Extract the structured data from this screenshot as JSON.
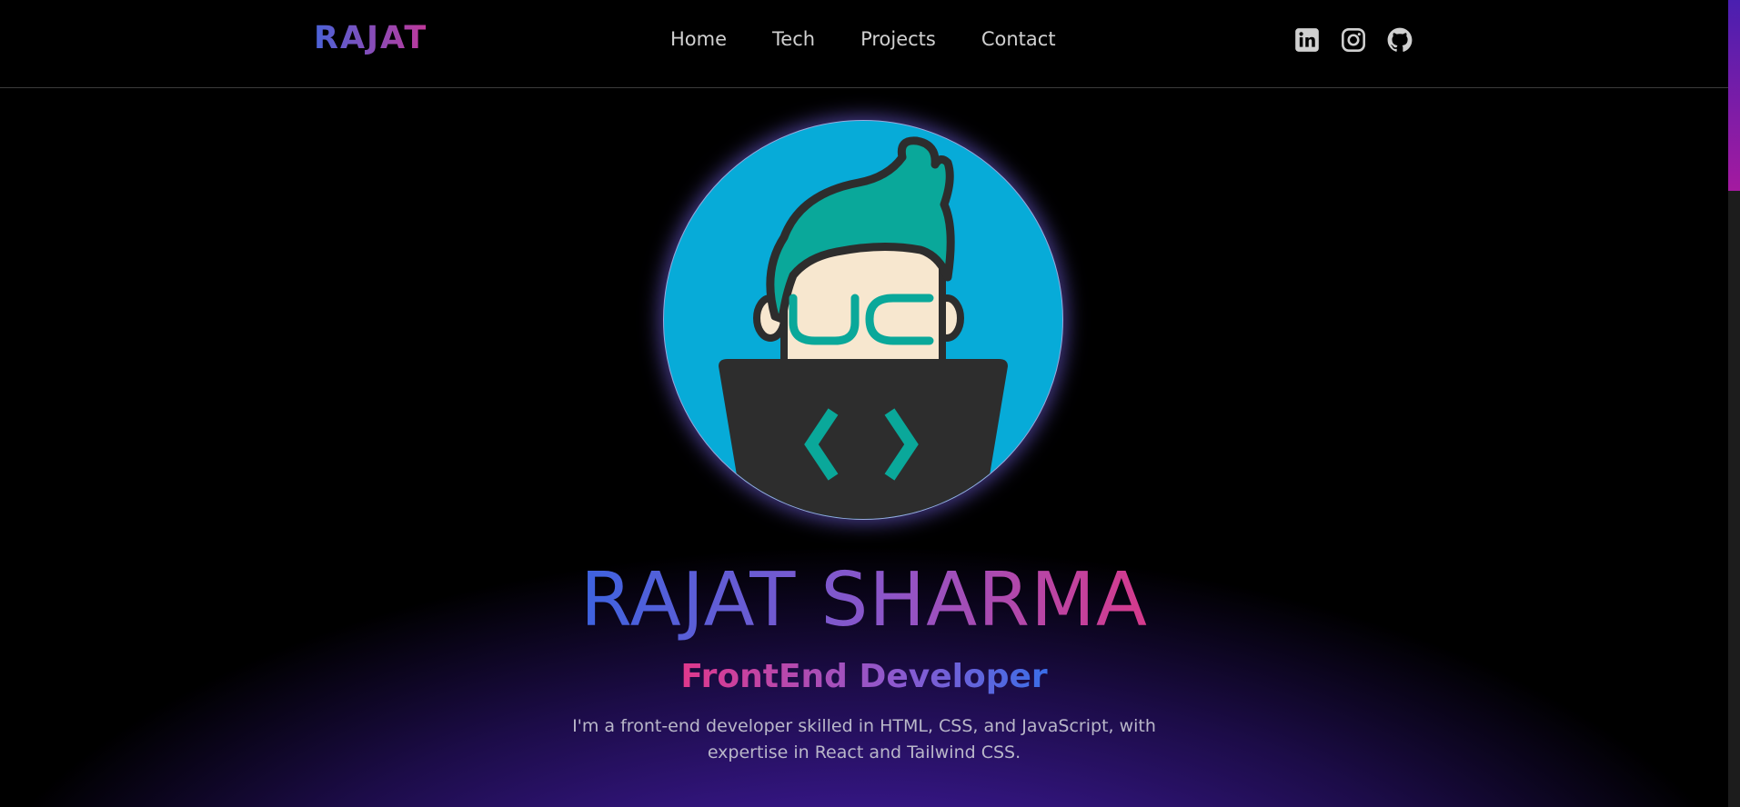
{
  "brand": {
    "logo": "RAJAT"
  },
  "nav": {
    "links": [
      "Home",
      "Tech",
      "Projects",
      "Contact"
    ]
  },
  "socials": [
    "linkedin-icon",
    "instagram-icon",
    "github-icon"
  ],
  "hero": {
    "name": "RAJAT SHARMA",
    "role": "FrontEnd Developer",
    "bio": "I'm a front-end developer skilled in HTML, CSS, and JavaScript, with expertise in React and Tailwind CSS.",
    "avatar_code_glyph": "< >"
  },
  "colors": {
    "background": "#000000",
    "glow": "#4a1fb0",
    "gradient_start": "#3d63e0",
    "gradient_end": "#d63a8c",
    "avatar_bg": "#07abd8"
  }
}
